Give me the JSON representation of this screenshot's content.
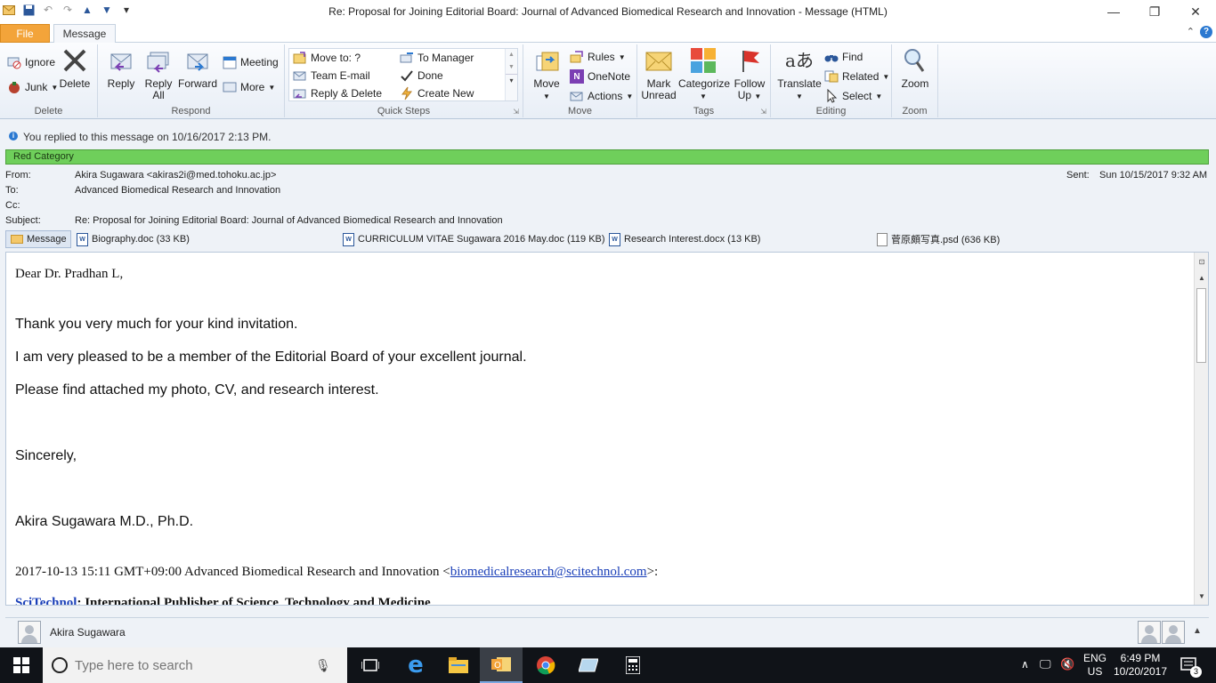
{
  "window": {
    "title": "Re: Proposal for Joining Editorial Board: Journal of Advanced Biomedical Research and Innovation  -  Message (HTML)"
  },
  "tabs": {
    "file": "File",
    "message": "Message"
  },
  "ribbon": {
    "delete": {
      "ignore": "Ignore",
      "junk": "Junk",
      "delete": "Delete",
      "label": "Delete"
    },
    "respond": {
      "reply": "Reply",
      "reply_all_1": "Reply",
      "reply_all_2": "All",
      "forward": "Forward",
      "meeting": "Meeting",
      "more": "More",
      "label": "Respond"
    },
    "quick_steps": {
      "move_to": "Move to: ?",
      "team_email": "Team E-mail",
      "reply_delete": "Reply & Delete",
      "to_manager": "To Manager",
      "done": "Done",
      "create_new": "Create New",
      "label": "Quick Steps"
    },
    "move": {
      "move": "Move",
      "rules": "Rules",
      "onenote": "OneNote",
      "actions": "Actions",
      "label": "Move"
    },
    "tags": {
      "mark_unread_1": "Mark",
      "mark_unread_2": "Unread",
      "categorize": "Categorize",
      "follow_up_1": "Follow",
      "follow_up_2": "Up",
      "label": "Tags"
    },
    "editing": {
      "translate": "Translate",
      "find": "Find",
      "related": "Related",
      "select": "Select",
      "label": "Editing"
    },
    "zoom": {
      "zoom": "Zoom",
      "label": "Zoom"
    }
  },
  "info": {
    "replied": "You replied to this message on 10/16/2017 2:13 PM."
  },
  "category": "Red Category",
  "header": {
    "from_label": "From:",
    "from": "Akira Sugawara <akiras2i@med.tohoku.ac.jp>",
    "to_label": "To:",
    "to": "Advanced Biomedical Research and Innovation",
    "cc_label": "Cc:",
    "subject_label": "Subject:",
    "subject": "Re: Proposal for Joining Editorial Board: Journal of Advanced Biomedical Research and Innovation",
    "sent_label": "Sent:",
    "sent": "Sun 10/15/2017 9:32 AM"
  },
  "attachments": {
    "message": "Message",
    "items": [
      "Biography.doc (33 KB)",
      "CURRICULUM VITAE Sugawara 2016 May.doc (119 KB)",
      "Research Interest.docx (13 KB)",
      "菅原頗写真.psd (636 KB)"
    ]
  },
  "body": {
    "greeting": "Dear Dr. Pradhan L,",
    "line1": "Thank you very much for your kind invitation.",
    "line2": "I am very pleased to be a member of the Editorial Board of your excellent journal.",
    "line3": "Please find attached my photo, CV, and research interest.",
    "closing": "Sincerely,",
    "signature": "Akira Sugawara M.D., Ph.D.",
    "quote_prefix": "2017-10-13 15:11 GMT+09:00 Advanced Biomedical Research and Innovation <",
    "quote_email": "biomedicalresearch@scitechnol.com",
    "quote_suffix": ">:",
    "next_line_link": "SciTechnol",
    "next_line_rest": ": International Publisher of Science, Technology and Medicine"
  },
  "people": {
    "name": "Akira Sugawara"
  },
  "taskbar": {
    "search_placeholder": "Type here to search",
    "lang_1": "ENG",
    "lang_2": "US",
    "time": "6:49 PM",
    "date": "10/20/2017",
    "notifications": "3"
  },
  "colors": {
    "file_tab": "#f3a43a",
    "category_green": "#6fcf5b",
    "link_blue": "#1a3fb8",
    "taskbar": "#101318"
  }
}
